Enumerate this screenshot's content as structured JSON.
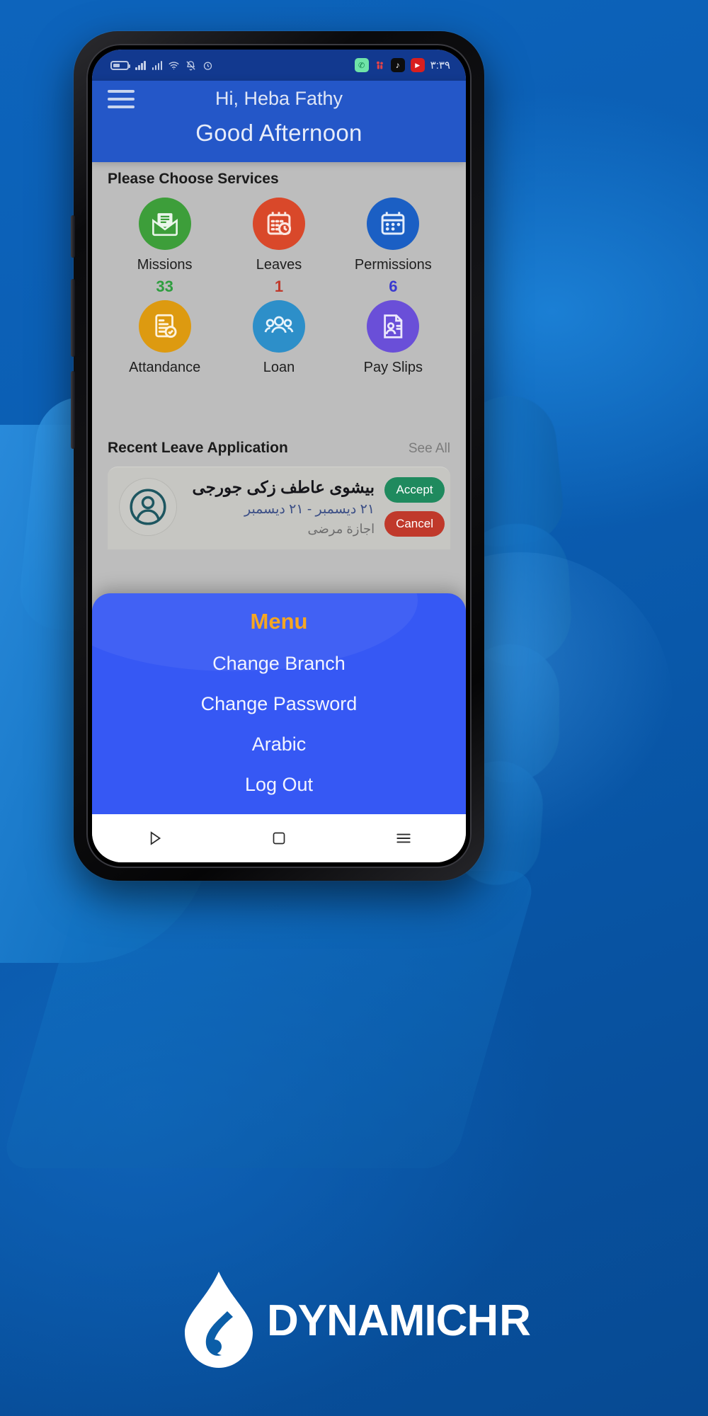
{
  "status_bar": {
    "time": "٣:٣٩",
    "left_icons": [
      "battery-icon",
      "signal-icon",
      "signal-icon",
      "wifi-icon",
      "bell-off-icon",
      "alarm-icon"
    ],
    "right_icons": [
      "whatsapp-icon",
      "notification-icon",
      "tiktok-icon",
      "youtube-icon"
    ],
    "tiktok_glyph": "♪",
    "youtube_glyph": "▶",
    "whatsapp_glyph": "✆"
  },
  "header": {
    "menu_icon": "hamburger-icon",
    "greeting": "Hi, Heba Fathy",
    "subtitle": "Good Afternoon"
  },
  "services": {
    "title": "Please Choose Services",
    "items": [
      {
        "label": "Missions",
        "count": "33",
        "count_color": "#2e9e3f",
        "icon": "mail-document-icon",
        "bg": "#3d9e3a"
      },
      {
        "label": "Leaves",
        "count": "1",
        "count_color": "#c0392b",
        "icon": "calendar-clock-icon",
        "bg": "#d9482a"
      },
      {
        "label": "Permissions",
        "count": "6",
        "count_color": "#3a3ad0",
        "icon": "calendar-dots-icon",
        "bg": "#1b5fc4"
      },
      {
        "label": "Attandance",
        "count": "",
        "count_color": "#000000",
        "icon": "document-check-icon",
        "bg": "#dd9a10"
      },
      {
        "label": "Loan",
        "count": "",
        "count_color": "#000000",
        "icon": "group-people-icon",
        "bg": "#2d8fc9"
      },
      {
        "label": "Pay Slips",
        "count": "",
        "count_color": "#000000",
        "icon": "payslip-person-icon",
        "bg": "#6a4fd8"
      }
    ]
  },
  "recent": {
    "title": "Recent Leave Application",
    "see_all": "See All",
    "card": {
      "avatar_icon": "user-avatar-icon",
      "name": "بيشوى عاطف زكى جورجى",
      "dates": "٢١ ديسمبر - ٢١ ديسمبر",
      "type": "اجازة مرضى",
      "accept_label": "Accept",
      "cancel_label": "Cancel"
    }
  },
  "menu_sheet": {
    "title": "Menu",
    "items": [
      "Change Branch",
      "Change Password",
      "Arabic",
      "Log Out"
    ]
  },
  "nav_bar": {
    "back_icon": "triangle-back-icon",
    "home_icon": "square-home-icon",
    "recents_icon": "lines-recents-icon"
  },
  "brand": {
    "logo_icon": "dynamic-drop-logo",
    "name": "DYNAMIC",
    "suffix": "HR"
  },
  "colors": {
    "page_bg": "#0a5cb0",
    "app_primary": "#2457c8",
    "status_bar": "#12398f",
    "card_bg": "#bdbdbd",
    "menu_bg": "#3658f4",
    "menu_title": "#f5a623",
    "accept": "#1f8a5e",
    "cancel": "#c0392b"
  }
}
